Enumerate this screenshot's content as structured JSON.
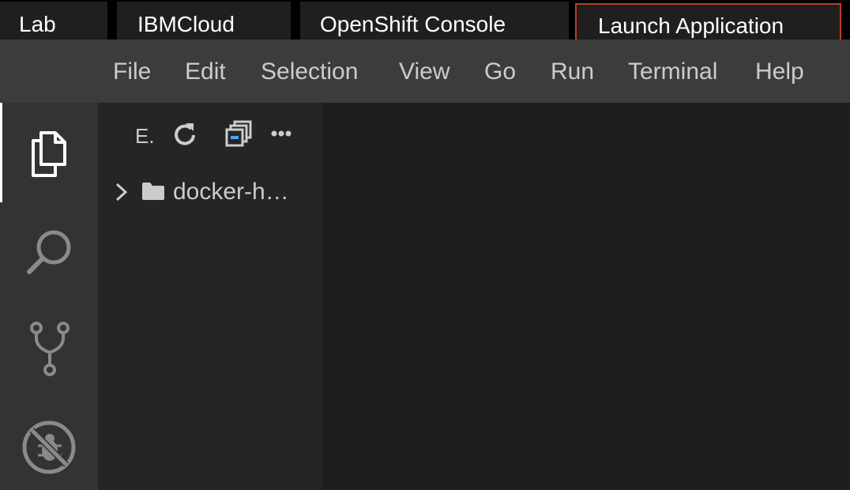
{
  "tabs": [
    {
      "label": "Lab"
    },
    {
      "label": "IBMCloud"
    },
    {
      "label": "OpenShift Console"
    },
    {
      "label": "Launch Application"
    }
  ],
  "menu": [
    "File",
    "Edit",
    "Selection",
    "View",
    "Go",
    "Run",
    "Terminal",
    "Help"
  ],
  "activity_bar": {
    "icons": [
      "explorer-icon",
      "search-icon",
      "source-control-icon",
      "debug-icon"
    ],
    "active": "explorer-icon"
  },
  "explorer": {
    "title": "E.",
    "actions": [
      "refresh-icon",
      "collapse-all-icon",
      "more-actions-icon"
    ],
    "tree": [
      {
        "label": "docker-h…",
        "type": "folder",
        "expanded": false
      }
    ]
  },
  "colors": {
    "tab_highlight_border": "#c0392b",
    "menubar_bg": "#3c3c3c",
    "activity_bg": "#333333",
    "sidebar_bg": "#252526",
    "editor_bg": "#1e1e1e"
  }
}
